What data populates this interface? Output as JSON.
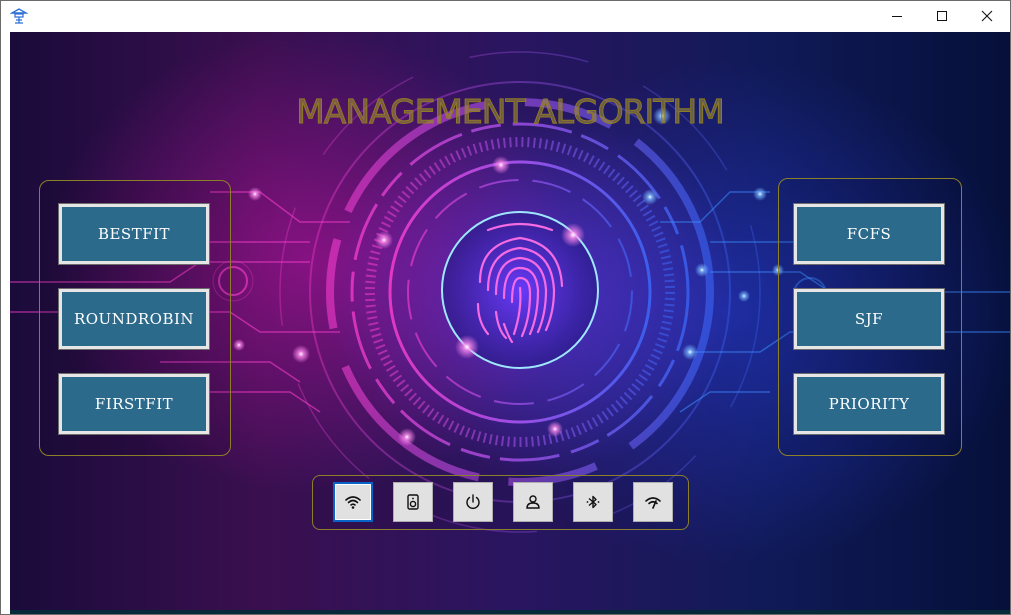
{
  "window": {
    "controls": {
      "minimize": "minimize-icon",
      "maximize": "maximize-icon",
      "close": "close-icon"
    }
  },
  "title": "MANAGEMENT ALGORITHM",
  "left_panel": {
    "buttons": [
      "BESTFIT",
      "ROUNDROBIN",
      "FIRSTFIT"
    ]
  },
  "right_panel": {
    "buttons": [
      "FCFS",
      "SJF",
      "PRIORITY"
    ]
  },
  "bottom_panel": {
    "icons": [
      "wifi-icon",
      "speaker-icon",
      "power-icon",
      "user-icon",
      "bluetooth-icon",
      "signal-icon"
    ],
    "focused": "wifi-icon"
  },
  "colors": {
    "button_fill": "#2c6a8c",
    "panel_border": "#8c7f2a",
    "title": "#8c7a24",
    "focus": "#0a64c8"
  }
}
